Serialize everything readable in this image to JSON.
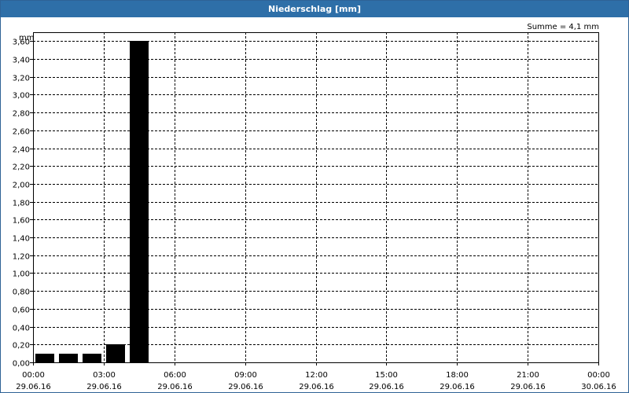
{
  "window": {
    "title": "Niederschlag [mm]"
  },
  "chart_data": {
    "type": "bar",
    "title": "Niederschlag [mm]",
    "annotation": "Summe = 4,1 mm",
    "ylabel": "mm",
    "ylim": [
      0,
      3.7
    ],
    "y_ticks": [
      "0,00",
      "0,20",
      "0,40",
      "0,60",
      "0,80",
      "1,00",
      "1,20",
      "1,40",
      "1,60",
      "1,80",
      "2,00",
      "2,20",
      "2,40",
      "2,60",
      "2,80",
      "3,00",
      "3,20",
      "3,40",
      "3,60"
    ],
    "y_tick_values": [
      0,
      0.2,
      0.4,
      0.6,
      0.8,
      1.0,
      1.2,
      1.4,
      1.6,
      1.8,
      2.0,
      2.2,
      2.4,
      2.6,
      2.8,
      3.0,
      3.2,
      3.4,
      3.6
    ],
    "x_range_hours": [
      0,
      24
    ],
    "x_ticks": [
      {
        "time": "00:00",
        "date": "29.06.16"
      },
      {
        "time": "03:00",
        "date": "29.06.16"
      },
      {
        "time": "06:00",
        "date": "29.06.16"
      },
      {
        "time": "09:00",
        "date": "29.06.16"
      },
      {
        "time": "12:00",
        "date": "29.06.16"
      },
      {
        "time": "15:00",
        "date": "29.06.16"
      },
      {
        "time": "18:00",
        "date": "29.06.16"
      },
      {
        "time": "21:00",
        "date": "29.06.16"
      },
      {
        "time": "00:00",
        "date": "30.06.16"
      }
    ],
    "series": [
      {
        "bars": [
          {
            "start": "00:00",
            "end": "01:00",
            "value": 0.1
          },
          {
            "start": "01:00",
            "end": "02:00",
            "value": 0.1
          },
          {
            "start": "02:00",
            "end": "03:00",
            "value": 0.1
          },
          {
            "start": "03:00",
            "end": "04:00",
            "value": 0.2
          },
          {
            "start": "04:00",
            "end": "05:00",
            "value": 3.6
          }
        ]
      }
    ],
    "grid": true,
    "bar_color": "#000000"
  }
}
